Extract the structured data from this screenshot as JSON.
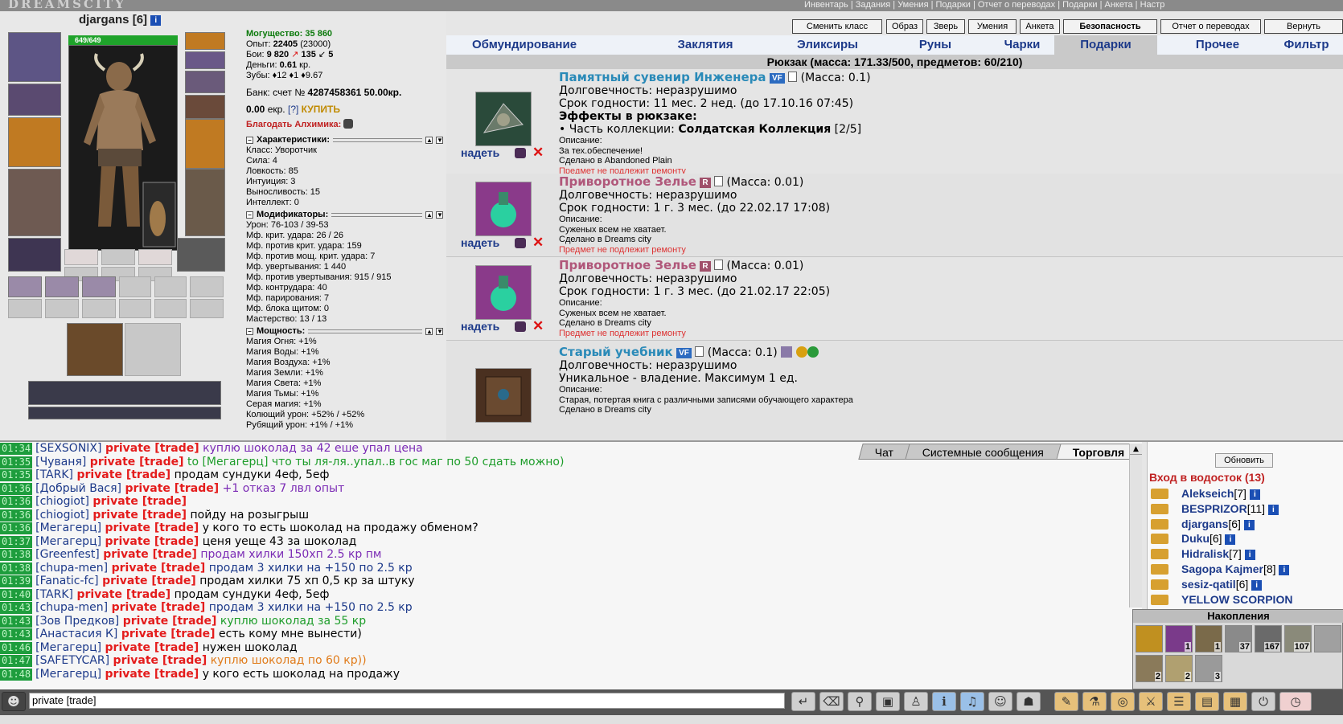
{
  "header": {
    "logo": "DREAMSCITY",
    "links": "Инвентарь | Задания | Умения | Подарки | Отчет о переводах | Подарки | Анкета | Настр"
  },
  "character": {
    "name": "djargans",
    "level": "[6]",
    "hp": "649/649"
  },
  "stats": {
    "power_label": "Могущество:",
    "power": "35 860",
    "exp_label": "Опыт:",
    "exp": "22405",
    "exp_next": "(23000)",
    "fights_label": "Бои:",
    "fights": "9 820",
    "wins": "135",
    "losses": "5",
    "money_label": "Деньги:",
    "money": "0.61",
    "money_unit": "кр.",
    "teeth_label": "Зубы:",
    "teeth": "♦12 ♦1 ♦9.67",
    "bank_label": "Банк: счет №",
    "bank_account": "4287458361",
    "bank_money": "50.00кр.",
    "ekr": "0.00",
    "ekr_unit": "екр.",
    "ekr_help": "[?]",
    "buy": "КУПИТЬ",
    "alchemist": "Благодать Алхимика:",
    "char_header": "Характеристики:",
    "class": "Класс: Уворотчик",
    "strength": "Сила: 4",
    "agility": "Ловкость: 85",
    "intuition": "Интуиция: 3",
    "endurance": "Выносливость: 15",
    "intellect": "Интеллект: 0",
    "mod_header": "Модификаторы:",
    "mods": [
      "Урон: 76-103 / 39-53",
      "Мф. крит. удара: 26 / 26",
      "Мф. против крит. удара: 159",
      "Мф. против мощ. крит. удара: 7",
      "Мф. увертывания: 1 440",
      "Мф. против увертывания: 915 / 915",
      "Мф. контрудара: 40",
      "Мф. парирования: 7",
      "Мф. блока щитом: 0",
      "Мастерство: 13 / 13"
    ],
    "power_header": "Мощность:",
    "powers": [
      "Магия Огня: +1%",
      "Магия Воды: +1%",
      "Магия Воздуха: +1%",
      "Магия Земли: +1%",
      "Магия Света: +1%",
      "Магия Тьмы: +1%",
      "Серая магия: +1%",
      "Колющий урон: +52% / +52%",
      "Рубящий урон: +1% / +1%"
    ]
  },
  "toolbar": [
    "Сменить класс",
    "Образ",
    "Зверь",
    "Умения",
    "Анкета",
    "Безопасность",
    "Отчет о переводах",
    "Вернуть"
  ],
  "tabs": [
    "Обмундирование",
    "Заклятия",
    "Эликсиры",
    "Руны",
    "Чарки",
    "Подарки",
    "Прочее",
    "Фильтр"
  ],
  "bag": "Рюкзак (масса: 171.33/500, предметов: 60/210)",
  "items": [
    {
      "wear": "надеть",
      "name": "Памятный сувенир Инженера",
      "badge": "VF",
      "mass": "(Масса: 0.1)",
      "lines": [
        "Долговечность: неразрушимо",
        "Срок годности: 11 мес. 2 нед. (до 17.10.16 07:45)"
      ],
      "effects_title": "Эффекты в рюкзаке:",
      "collection_label": "• Часть коллекции:",
      "collection": "Солдатская Коллекция",
      "collection_count": "[2/5]",
      "desc_label": "Описание:",
      "desc": "За тех.обеспечение!",
      "made": "Сделано в Abandoned Plain",
      "repair": "Предмет не подлежит ремонту"
    },
    {
      "wear": "надеть",
      "name": "Приворотное Зелье",
      "badge": "R",
      "mass": "(Масса: 0.01)",
      "lines": [
        "Долговечность: неразрушимо",
        "Срок годности: 1 г. 3 мес. (до 22.02.17 17:08)"
      ],
      "desc_label": "Описание:",
      "desc": "Суженых всем не хватает.",
      "made": "Сделано в Dreams city",
      "repair": "Предмет не подлежит ремонту"
    },
    {
      "wear": "надеть",
      "name": "Приворотное Зелье",
      "badge": "R",
      "mass": "(Масса: 0.01)",
      "lines": [
        "Долговечность: неразрушимо",
        "Срок годности: 1 г. 3 мес. (до 21.02.17 22:05)"
      ],
      "desc_label": "Описание:",
      "desc": "Суженых всем не хватает.",
      "made": "Сделано в Dreams city",
      "repair": "Предмет не подлежит ремонту"
    },
    {
      "name": "Старый учебник",
      "badge": "VF",
      "mass": "(Масса: 0.1)",
      "lines": [
        "Долговечность: неразрушимо",
        "Уникальное - владение. Максимум 1 ед."
      ],
      "desc_label": "Описание:",
      "desc": "Старая, потертая книга с различными записями обучающего характера",
      "made": "Сделано в Dreams city"
    }
  ],
  "chat_tabs": [
    "Чат",
    "Системные сообщения",
    "Торговля"
  ],
  "chat": [
    {
      "time": "01:34",
      "nick": "[SEXSONIX]",
      "tag": "private [trade]",
      "msg": "куплю шоколад за 42 еше упал цена",
      "color": "#7b2bb5"
    },
    {
      "time": "01:35",
      "nick": "[Чуваня]",
      "tag": "private [trade]",
      "msg": "to [Мегагерц] что ты ля-ля..упал..в гос маг по 50 сдать можно)",
      "color": "#1e9d2b"
    },
    {
      "time": "01:35",
      "nick": "[TARK]",
      "tag": "private [trade]",
      "msg": "продам сундуки 4еф, 5еф",
      "color": "#000000"
    },
    {
      "time": "01:36",
      "nick": "[Добрый Вася]",
      "tag": "private [trade]",
      "msg": "+1 отказ 7 лвл опыт",
      "color": "#7b2bb5"
    },
    {
      "time": "01:36",
      "nick": "[chiogiot]",
      "tag": "private [trade]",
      "msg": "",
      "color": "#000000"
    },
    {
      "time": "01:36",
      "nick": "[chiogiot]",
      "tag": "private [trade]",
      "msg": "пойду на розыгрыш",
      "color": "#000000"
    },
    {
      "time": "01:36",
      "nick": "[Мегагерц]",
      "tag": "private [trade]",
      "msg": "у кого то есть шоколад на продажу обменом?",
      "color": "#000000"
    },
    {
      "time": "01:37",
      "nick": "[Мегагерц]",
      "tag": "private [trade]",
      "msg": "ценя уеще 43 за шоколад",
      "color": "#000000"
    },
    {
      "time": "01:38",
      "nick": "[Greenfest]",
      "tag": "private [trade]",
      "msg": "продам хилки 150хп 2.5 кр пм",
      "color": "#7b2bb5"
    },
    {
      "time": "01:38",
      "nick": "[chupa-men]",
      "tag": "private [trade]",
      "msg": "продам 3 хилки на +150 по 2.5 кр",
      "color": "#1d3a8a"
    },
    {
      "time": "01:39",
      "nick": "[Fanatic-fc]",
      "tag": "private [trade]",
      "msg": "продам хилки 75 хп 0,5 кр за штуку",
      "color": "#000000"
    },
    {
      "time": "01:40",
      "nick": "[TARK]",
      "tag": "private [trade]",
      "msg": "продам сундуки 4еф, 5еф",
      "color": "#000000"
    },
    {
      "time": "01:43",
      "nick": "[chupa-men]",
      "tag": "private [trade]",
      "msg": "продам 3 хилки на +150 по 2.5 кр",
      "color": "#1d3a8a"
    },
    {
      "time": "01:43",
      "nick": "[Зов Предков]",
      "tag": "private [trade]",
      "msg": "куплю шоколад за 55 кр",
      "color": "#1e9d2b"
    },
    {
      "time": "01:43",
      "nick": "[Анастасия К]",
      "tag": "private [trade]",
      "msg": "есть кому мне вынести)",
      "color": "#000000"
    },
    {
      "time": "01:46",
      "nick": "[Мегагерц]",
      "tag": "private [trade]",
      "msg": "нужен шоколад",
      "color": "#000000"
    },
    {
      "time": "01:47",
      "nick": "[SAFETYCAR]",
      "tag": "private [trade]",
      "msg": "куплю шоколад по 60 кр))",
      "color": "#e07b1a"
    },
    {
      "time": "01:48",
      "nick": "[Мегагерц]",
      "tag": "private [trade]",
      "msg": "у кого есть шоколад на продажу",
      "color": "#000000"
    }
  ],
  "room": {
    "refresh": "Обновить",
    "title": "Вход в водосток (13)",
    "users": [
      {
        "name": "Alekseich",
        "level": "[7]"
      },
      {
        "name": "BESPRIZOR",
        "level": "[11]"
      },
      {
        "name": "djargans",
        "level": "[6]"
      },
      {
        "name": "Duku",
        "level": "[6]"
      },
      {
        "name": "Hidralisk",
        "level": "[7]"
      },
      {
        "name": "Sagopa Kajmer",
        "level": "[8]"
      },
      {
        "name": "sesiz-qatil",
        "level": "[6]"
      },
      {
        "name": "YELLOW SCORPION",
        "level": ""
      }
    ]
  },
  "nakop": {
    "title": "Накопления",
    "counts": [
      "",
      "1",
      "1",
      "37",
      "167",
      "107",
      "",
      "2",
      "2",
      "3"
    ]
  },
  "input": {
    "value": "private [trade]"
  },
  "colors": {
    "accent": "#1d3a8a",
    "trade_red": "#e41c1c",
    "time_green": "#1e9d3d"
  }
}
